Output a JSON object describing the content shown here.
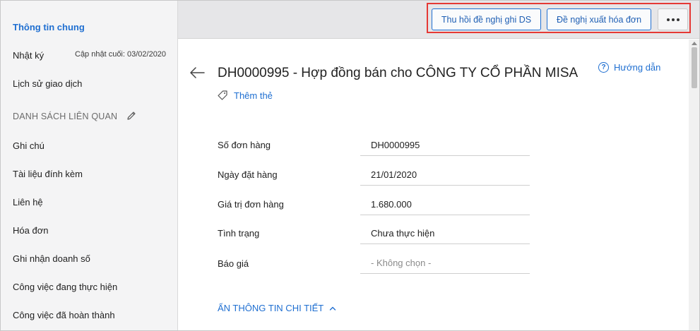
{
  "sidebar": {
    "general_info": "Thông tin chung",
    "log": "Nhật ký",
    "last_updated": "Cập nhật cuối: 03/02/2020",
    "transaction_history": "Lịch sử giao dịch",
    "related_list_heading": "DANH SÁCH LIÊN QUAN",
    "items": [
      "Ghi chú",
      "Tài liệu đính kèm",
      "Liên hệ",
      "Hóa đơn",
      "Ghi nhận doanh số",
      "Công việc đang thực hiện",
      "Công việc đã hoàn thành"
    ]
  },
  "toolbar": {
    "revoke_button": "Thu hồi đề nghị ghi DS",
    "invoice_request_button": "Đề nghị xuất hóa đơn",
    "more_icon": "more-horizontal-icon"
  },
  "header": {
    "title": "DH0000995 - Hợp đồng bán cho CÔNG TY CỔ PHẦN MISA",
    "help_label": "Hướng dẫn",
    "help_icon": "?",
    "add_tag_label": "Thêm thẻ"
  },
  "fields": [
    {
      "label": "Số đơn hàng",
      "value": "DH0000995"
    },
    {
      "label": "Ngày đặt hàng",
      "value": "21/01/2020"
    },
    {
      "label": "Giá trị đơn hàng",
      "value": "1.680.000"
    },
    {
      "label": "Tình trạng",
      "value": "Chưa thực hiện"
    },
    {
      "label": "Báo giá",
      "value": "- Không chọn -"
    }
  ],
  "hide_details_label": "ẨN THÔNG TIN CHI TIẾT",
  "colors": {
    "accent": "#1f6fd1",
    "highlight_border": "#e53935",
    "sidebar_bg": "#f4f4f5",
    "topbar_bg": "#e6e6e8"
  }
}
